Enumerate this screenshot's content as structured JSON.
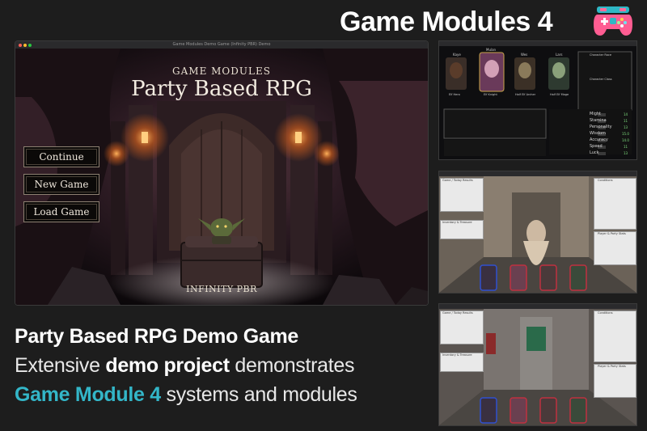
{
  "header": {
    "title": "Game Modules 4"
  },
  "icons": {
    "gamepad": "gamepad-icon"
  },
  "colors": {
    "accent": "#33b6c8",
    "background": "#1d1d1d"
  },
  "main_window": {
    "title": "Game Modules Demo Game (Infinity PBR) Demo",
    "subtitle": "GAME MODULES",
    "game_title": "Party Based RPG",
    "buttons": [
      "Continue",
      "New Game",
      "Load Game"
    ],
    "footer_logo": "INFINITY PBR"
  },
  "headline": {
    "line1": "Party Based RPG Demo Game",
    "line2_pre": "Extensive ",
    "line2_bold": "demo project",
    "line2_post": " demonstrates",
    "line3_accent": "Game Module 4",
    "line3_post": " systems and modules"
  },
  "panel1": {
    "names": [
      "Kaye",
      "Mulan",
      "Wes",
      "Lars"
    ],
    "classes": [
      "Elf Hero",
      "Elf Knight",
      "Half Elf Archer",
      "Half Elf Mage"
    ],
    "race_title": "Character Race",
    "class_title": "Character Class",
    "stats": [
      "Might",
      "Stamina",
      "Personality",
      "Wisdom",
      "Accuracy",
      "Speed",
      "Luck"
    ],
    "stat_values": [
      "14",
      "11",
      "13",
      "15.0",
      "14.0",
      "11",
      "13"
    ],
    "totals": [
      "0",
      "0",
      "38"
    ]
  },
  "panel2": {
    "left_title": "Game / Today Results",
    "left_sub": "Inventory & Treasure",
    "right_title": "Conditions",
    "right_sub": "Player & Party Stats"
  },
  "panel3": {
    "left_title": "Game / Today Results",
    "left_sub": "Inventory & Treasure",
    "right_title": "Conditions",
    "right_sub": "Player & Party Stats"
  }
}
